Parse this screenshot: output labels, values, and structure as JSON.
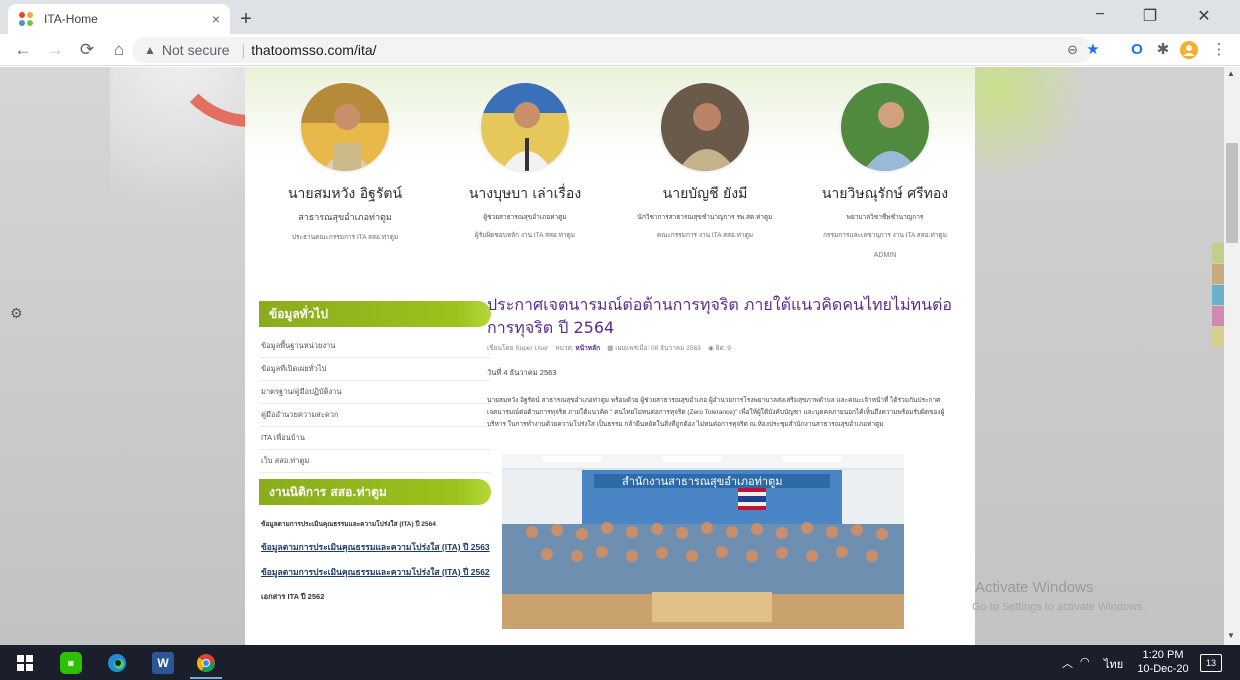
{
  "browser": {
    "tab_title": "ITA-Home",
    "tab_close": "×",
    "new_tab": "+",
    "security": "Not secure",
    "url": "thatoomsso.com/ita/",
    "min": "−",
    "restore": "❐",
    "close": "✕"
  },
  "staff": [
    {
      "name": "นายสมหวัง อิฐรัตน์",
      "position": "สาธารณสุขอำเภอท่าตูม",
      "role": "ประธานคณะกรรมการ ITA สสอ.ท่าตูม"
    },
    {
      "name": "นางบุษบา เล่าเรื่อง",
      "position": "ผู้ช่วยสาธารณสุขอำเภอท่าตูม",
      "role": "ผู้รับผิดชอบหลัก งาน ITA สสอ.ท่าตูม"
    },
    {
      "name": "นายบัญชี ยังมี",
      "position": "นักวิชาการสาธารณสุขชำนาญการ รพ.สต.ท่าตูม",
      "role": "คณะกรรมการ งาน ITA สสอ.ท่าตูม"
    },
    {
      "name": "นายวิษณุรักษ์ ศรีทอง",
      "position": "พยาบาลวิชาชีพชำนาญการ",
      "role": "กรรมการและเลขานุการ งาน ITA สสอ.ท่าตูม",
      "extra": "ADMIN"
    }
  ],
  "sidebar": {
    "module1_title": "ข้อมูลทั่วไป",
    "module1_items": [
      "ข้อมูลพื้นฐานหน่วยงาน",
      "ข้อมูลที่เปิดเผยทั่วไป",
      "มาตรฐาน/คู่มือปฏิบัติงาน",
      "คู่มืออำนวยความสะดวก",
      "ITA เพื่อนบ้าน",
      "เว็บ สสอ.ท่าตูม"
    ],
    "module2_title": "งานนิติการ สสอ.ท่าตูม",
    "module2_items": [
      "ข้อมูลตามการประเมินคุณธรรมและความโปร่งใส (ITA) ปี 2564",
      "ข้อมูลตามการประเมินคุณธรรมและความโปร่งใส (ITA) ปี 2563",
      "ข้อมูลตามการประเมินคุณธรรมและความโปร่งใส (ITA) ปี 2562",
      "เอกสาร ITA ปี 2562"
    ]
  },
  "article": {
    "title": "ประกาศเจตนารมณ์ต่อต้านการทุจริต ภายใต้แนวคิดคนไทยไม่ทนต่อการทุจริต ปี 2564",
    "meta_author": "เขียนโดย Super User",
    "meta_cat_label": "หมวด:",
    "meta_cat": "หน้าหลัก",
    "meta_date": "เผยแพร่เมื่อ: 08 ธันวาคม 2563",
    "meta_hits": "ฮิต: 9",
    "date": "วันที่ 4 ธันวาคม 2563",
    "body": "นายสมหวัง อิฐรัตน์ สาธารณสุขอำเภอท่าตูม พร้อมด้วย ผู้ช่วยสาธารณสุขอำเภอ ผู้อำนวยการโรงพยาบาลส่งเสริมสุขภาพตำบล และคณะเจ้าหน้าที่ ได้ร่วมกันประกาศเจตนารมณ์ต่อต้านการทุจริต ภายใต้แนวคิด \" คนไทยไม่ทนต่อการทุจริต (Zero Tolerance)\" เพื่อให้ผู้ใต้บังคับบัญชา และบุคคลภายนอกได้เห็นถึงความพร้อมรับผิดของผู้บริหาร ในการทำงานด้วยความโปร่งใส เป็นธรรม กล้ายืนหยัดในสิ่งที่ถูกต้อง ไม่ทนต่อการทุจริต ณ.ห้องประชุมสำนักงานสาธารณสุขอำเภอท่าตูม",
    "photo_sign": "สำนักงานสาธารณสุขอำเภอท่าตูม"
  },
  "watermark": {
    "line1": "Activate Windows",
    "line2": "Go to Settings to activate Windows."
  },
  "taskbar": {
    "lang": "ไทย",
    "time": "1:20 PM",
    "date": "10-Dec-20",
    "notif": "13"
  },
  "colors": {
    "accent_green": "#8aac1c",
    "title_purple": "#5d2b8c"
  }
}
